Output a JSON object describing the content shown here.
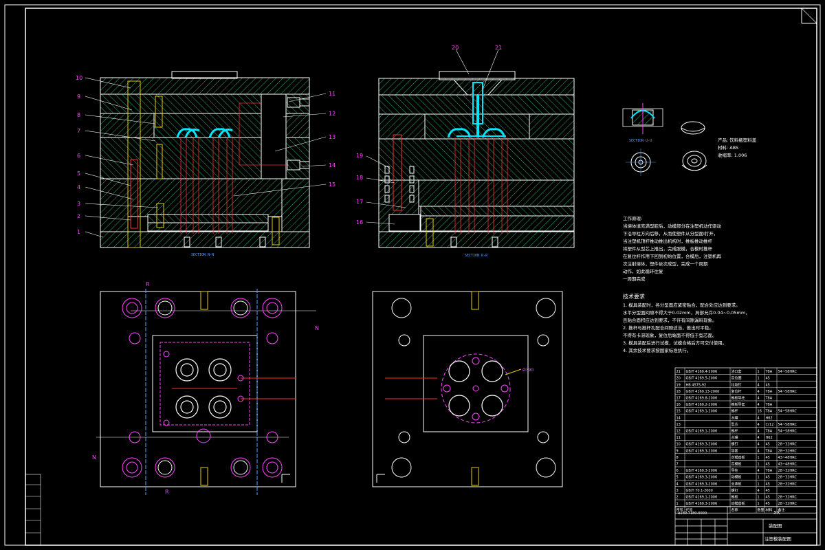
{
  "sections": {
    "left": "SECTION N-N",
    "right": "SECTION R-R",
    "small": "SECTION U-U"
  },
  "callouts_left": [
    "10",
    "9",
    "8",
    "7",
    "6",
    "5",
    "4",
    "3",
    "2",
    "1",
    "11",
    "12",
    "13",
    "14",
    "15"
  ],
  "callouts_right": [
    "20",
    "21",
    "19",
    "18",
    "17",
    "16"
  ],
  "view_marks": {
    "r": "R",
    "n": "N",
    "dia": "Ø390"
  },
  "product": {
    "name": "产品: 饮料瓶塑料盖",
    "material": "材料: ABS",
    "shrink": "收缩率: 1.006"
  },
  "work_process": {
    "title": "工作原理:",
    "lines": [
      "当熔体填充满型腔后，动模部分在注塑机动作驱动",
      "下沿导柱方向后移，从而使塑件从分型面I打开，",
      "当注塑机顶杆推动推出机构时，推板推动推杆",
      "将塑件从型芯上推出，完成脱模，合模时推杆",
      "在复位杆作用下回到初始位置，合模后，注塑机再",
      "次注射熔体，塑件依次成型，完成一个周期",
      "动作，如此循环往复",
      "一周期完成"
    ]
  },
  "tech_req": {
    "title": "技术要求",
    "lines": [
      "1. 模具装配时，各分型面应紧密贴合，配合处应达到要求。",
      "水平分型面间隙不得大于0.02mm，局部允许0.04~0.05mm，",
      "且贴合面积应达到要求，不许有间隙漏料现象。",
      "2. 推杆与推杆孔配合间隙适当，推出时平稳。",
      "不得有卡滞现象，复位后端面不得低于型芯面。",
      "3. 模具装配后进行试模，试模合格后方可交付使用。",
      "4. 其余技术要求按国家标准执行。"
    ]
  },
  "bom": [
    {
      "no": "21",
      "code": "GB/T 4169.4-2006",
      "name": "浇口套",
      "qty": "1",
      "mat": "T8A",
      "note": "54~58HRC"
    },
    {
      "no": "20",
      "code": "GB/T 4169.5-2006",
      "name": "定位圈",
      "qty": "1",
      "mat": "45",
      "note": ""
    },
    {
      "no": "19",
      "code": "HB 4575-92",
      "name": "垃圾钉",
      "qty": "4",
      "mat": "45",
      "note": ""
    },
    {
      "no": "18",
      "code": "GB/T 4169.13-2006",
      "name": "复位杆",
      "qty": "4",
      "mat": "T8A",
      "note": "54~58HRC"
    },
    {
      "no": "17",
      "code": "GB/T 4169.8-2006",
      "name": "推板导柱",
      "qty": "4",
      "mat": "T8A",
      "note": ""
    },
    {
      "no": "16",
      "code": "GB/T 4169.2-2006",
      "name": "推板导套",
      "qty": "4",
      "mat": "T8A",
      "note": ""
    },
    {
      "no": "15",
      "code": "GB/T 4169.1-2006",
      "name": "推杆",
      "qty": "16",
      "mat": "T8A",
      "note": "54~58HRC"
    },
    {
      "no": "14",
      "code": "",
      "name": "水嘴",
      "qty": "4",
      "mat": "H62",
      "note": ""
    },
    {
      "no": "13",
      "code": "",
      "name": "型芯",
      "qty": "4",
      "mat": "Cr12",
      "note": "54~58HRC"
    },
    {
      "no": "12",
      "code": "GB/T 4169.1-2006",
      "name": "推杆",
      "qty": "4",
      "mat": "T8A",
      "note": "54~58HRC"
    },
    {
      "no": "11",
      "code": "",
      "name": "水嘴",
      "qty": "4",
      "mat": "H62",
      "note": ""
    },
    {
      "no": "10",
      "code": "GB/T 4169.3-2006",
      "name": "螺钉",
      "qty": "4",
      "mat": "45",
      "note": "28~32HRC"
    },
    {
      "no": "9",
      "code": "GB/T 4169.3-2006",
      "name": "导套",
      "qty": "4",
      "mat": "T8A",
      "note": "28~32HRC"
    },
    {
      "no": "8",
      "code": "",
      "name": "定模座板",
      "qty": "1",
      "mat": "45",
      "note": "43~48HRC"
    },
    {
      "no": "7",
      "code": "",
      "name": "定模板",
      "qty": "1",
      "mat": "45",
      "note": "43~48HRC"
    },
    {
      "no": "6",
      "code": "GB/T 4169.3-2006",
      "name": "导柱",
      "qty": "4",
      "mat": "T8A",
      "note": "28~32HRC"
    },
    {
      "no": "5",
      "code": "GB/T 4169.3-2006",
      "name": "动模板",
      "qty": "1",
      "mat": "45",
      "note": "28~32HRC"
    },
    {
      "no": "4",
      "code": "GB/T 4169.3-2006",
      "name": "支承板",
      "qty": "1",
      "mat": "45",
      "note": "28~32HRC"
    },
    {
      "no": "3",
      "code": "GB/T 70.1-2000",
      "name": "螺钉",
      "qty": "4",
      "mat": "45",
      "note": ""
    },
    {
      "no": "2",
      "code": "GB/T 4169.1-2006",
      "name": "推板",
      "qty": "1",
      "mat": "45",
      "note": "28~32HRC"
    },
    {
      "no": "1",
      "code": "GB/T 4169.3-2006",
      "name": "动模座板",
      "qty": "1",
      "mat": "45",
      "note": "28~32HRC"
    }
  ],
  "bom_header": {
    "no": "序号",
    "code": "代号",
    "name": "名称",
    "qty": "数量",
    "mat": "材料",
    "note": "备注"
  },
  "title_block": {
    "drawing_no": "A160-7180-0000",
    "unit": "XX",
    "title": "装配图",
    "subtitle": "注塑模装配图"
  },
  "colors": {
    "outline": "#ffffff",
    "hatch": "#2a9a6a",
    "label": "#ff44ff",
    "cyan": "#00e5ff",
    "blue": "#5aa0ff",
    "red": "#ff3030",
    "yellow": "#e8d100",
    "paper": "#000000"
  }
}
